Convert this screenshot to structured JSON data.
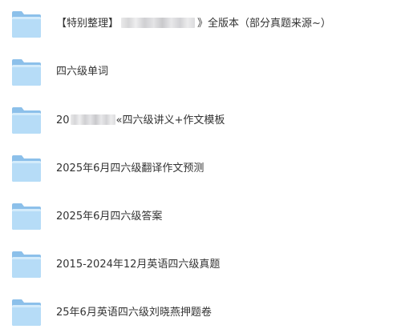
{
  "folders": [
    {
      "prefix": "【特别整理】",
      "suffix": "》全版本（部分真题来源~）"
    },
    {
      "text": "四六级单词"
    },
    {
      "prefix": "20",
      "suffix": "«四六级讲义+作文模板"
    },
    {
      "text": "2025年6月四六级翻译作文预测"
    },
    {
      "text": "2025年6月四六级答案"
    },
    {
      "text": "2015-2024年12月英语四六级真题"
    },
    {
      "text": "25年6月英语四六级刘晓燕押题卷"
    }
  ],
  "colors": {
    "folder_back": "#8cc0ea",
    "folder_front": "#b6dcf7",
    "text": "#333333"
  },
  "icon": "folder-icon"
}
